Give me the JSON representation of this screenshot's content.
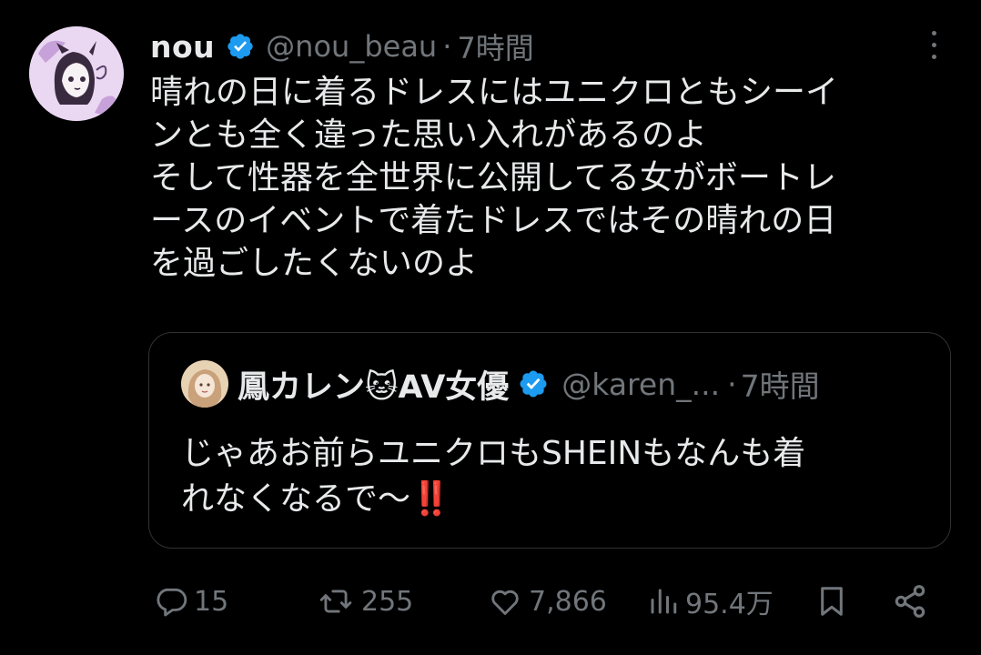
{
  "post": {
    "author_name": "nou",
    "handle": "@nou_beau",
    "separator": "·",
    "time": "7時間",
    "lines": [
      "晴れの日に着るドレスにはユニクロともシーイ",
      "ンとも全く違った思い入れがあるのよ",
      "そして性器を全世界に公開してる女がボートレ",
      "ースのイベントで着たドレスではその晴れの日",
      "を過ごしたくないのよ"
    ]
  },
  "quoted": {
    "author_name": "鳳カレン🐱AV女優",
    "handle": "@karen_...",
    "separator": "·",
    "time": "7時間",
    "lines": [
      "じゃあお前らユニクロもSHEINもなんも着",
      "れなくなるで〜‼️"
    ]
  },
  "actions": {
    "replies": "15",
    "reposts": "255",
    "likes": "7,866",
    "views": "95.4万"
  },
  "colors": {
    "background": "#000000",
    "text": "#e7e9ea",
    "secondary": "#71767b",
    "verified": "#1d9bf0",
    "border": "#2f3336"
  },
  "icons": [
    "verified-badge-icon",
    "more-icon",
    "reply-icon",
    "repost-icon",
    "like-icon",
    "views-icon",
    "bookmark-icon",
    "share-icon"
  ]
}
